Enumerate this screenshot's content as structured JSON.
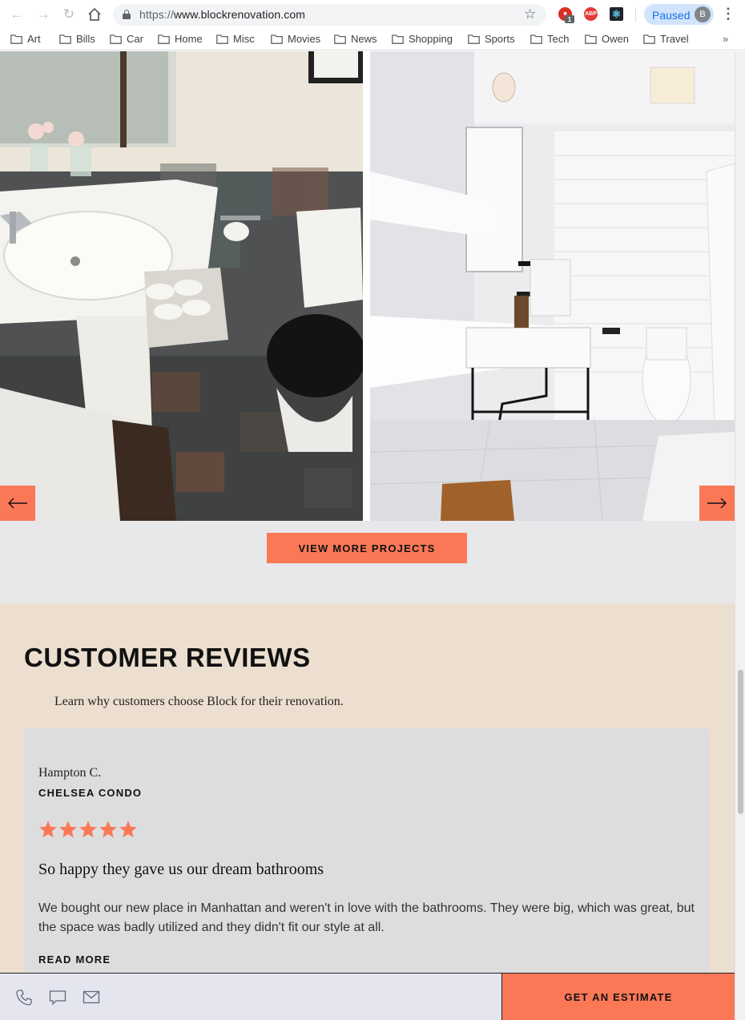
{
  "browser": {
    "url_scheme": "https://",
    "url_host": "www.blockrenovation.com",
    "profile_label": "Paused",
    "profile_initial": "B",
    "adblock_badge": "1",
    "abp_label": "ABP",
    "react_label": "⚛",
    "bookmarks": [
      "Art",
      "Bills",
      "Car",
      "Home",
      "Misc",
      "Movies",
      "News",
      "Shopping",
      "Sports",
      "Tech",
      "Owen",
      "Travel"
    ],
    "more": "»"
  },
  "gallery": {
    "prev_icon": "arrow-left-icon",
    "next_icon": "arrow-right-icon",
    "view_more_label": "VIEW MORE PROJECTS"
  },
  "reviews": {
    "title": "CUSTOMER REVIEWS",
    "subtitle": "Learn why customers choose Block for their renovation.",
    "card": {
      "name": "Hampton C.",
      "project": "CHELSEA CONDO",
      "rating": 5,
      "headline": "So happy they gave us our dream bathrooms",
      "body": "We bought our new place in Manhattan and weren't in love with the bathrooms. They were big, which was great, but the space was badly utilized and they didn't fit our style at all.",
      "read_more": "READ MORE"
    }
  },
  "footer": {
    "estimate_label": "GET AN ESTIMATE",
    "icons": [
      "phone-icon",
      "chat-icon",
      "mail-icon"
    ]
  },
  "colors": {
    "accent": "#fb7857",
    "reviews_bg": "#ecdfd0",
    "card_bg": "#dddddd",
    "footer_bg": "#e4e5ef"
  }
}
